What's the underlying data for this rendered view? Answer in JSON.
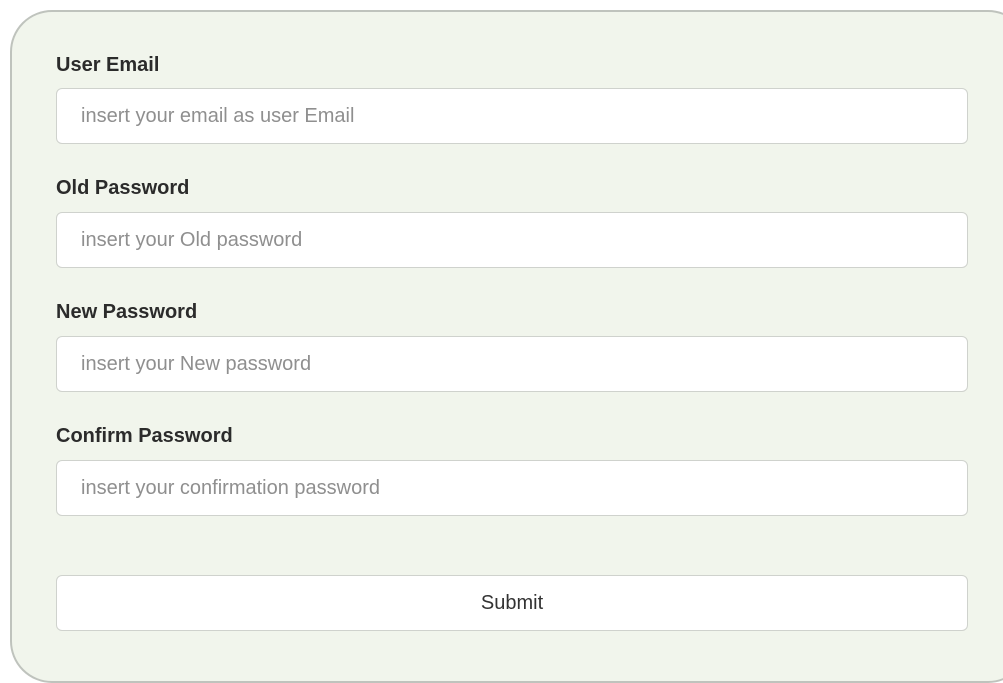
{
  "form": {
    "fields": [
      {
        "label": "User Email",
        "value": "",
        "placeholder": "insert your email as user Email"
      },
      {
        "label": "Old Password",
        "value": "",
        "placeholder": "insert your Old password"
      },
      {
        "label": "New Password",
        "value": "",
        "placeholder": "insert your New password"
      },
      {
        "label": "Confirm Password",
        "value": "",
        "placeholder": "insert your confirmation password"
      }
    ],
    "submit_label": "Submit"
  },
  "colors": {
    "panel_background": "#f1f5ec",
    "panel_border": "#bfc3bd",
    "input_border": "#cfd2cd",
    "label_text": "#2b2b2b",
    "placeholder_text": "#8f8f8f"
  }
}
